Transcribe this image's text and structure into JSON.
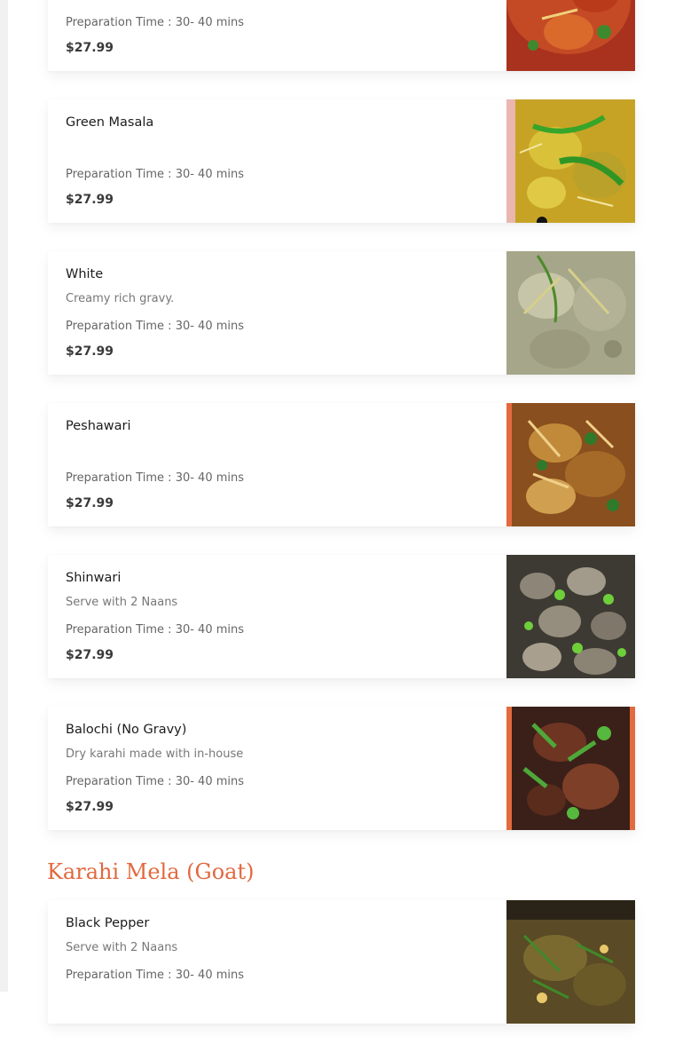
{
  "sections": [
    {
      "title": "",
      "items": [
        {
          "name": "",
          "description": "",
          "prep_time": "Preparation Time : 30- 40 mins",
          "price": "$27.99",
          "image_icon": "karahi-dish-photo"
        },
        {
          "name": "Green Masala",
          "description": "",
          "prep_time": "Preparation Time : 30- 40 mins",
          "price": "$27.99",
          "image_icon": "green-masala-photo"
        },
        {
          "name": "White",
          "description": "Creamy rich gravy.",
          "prep_time": "Preparation Time : 30- 40 mins",
          "price": "$27.99",
          "image_icon": "white-karahi-photo"
        },
        {
          "name": "Peshawari",
          "description": "",
          "prep_time": "Preparation Time : 30- 40 mins",
          "price": "$27.99",
          "image_icon": "peshawari-karahi-photo"
        },
        {
          "name": "Shinwari",
          "description": "Serve with 2 Naans",
          "prep_time": "Preparation Time : 30- 40 mins",
          "price": "$27.99",
          "image_icon": "shinwari-karahi-photo"
        },
        {
          "name": "Balochi (No Gravy)",
          "description": "Dry karahi made with in-house",
          "prep_time": "Preparation Time : 30- 40 mins",
          "price": "$27.99",
          "image_icon": "balochi-karahi-photo"
        }
      ]
    },
    {
      "title": "Karahi Mela (Goat)",
      "items": [
        {
          "name": "Black Pepper",
          "description": "Serve with 2 Naans",
          "prep_time": "Preparation Time : 30- 40 mins",
          "price": "",
          "image_icon": "black-pepper-karahi-photo"
        }
      ]
    }
  ],
  "colors": {
    "section_title": "#e2683e",
    "price": "#3a3a3a",
    "muted_text": "#777777"
  }
}
